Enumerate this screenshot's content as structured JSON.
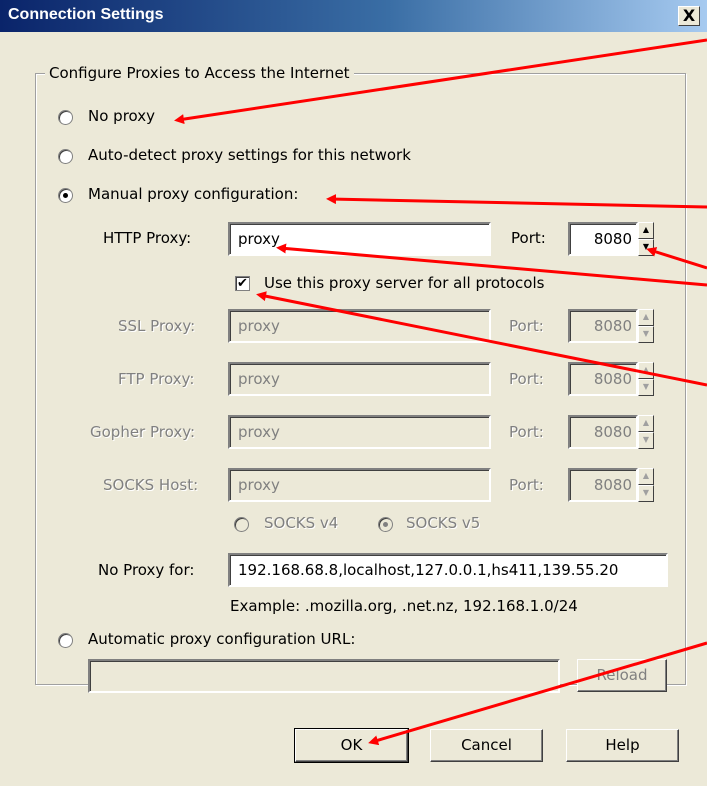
{
  "window": {
    "title": "Connection Settings",
    "close_label": "X"
  },
  "group": {
    "legend": "Configure Proxies to Access the Internet"
  },
  "options": {
    "no_proxy": "No proxy",
    "auto_detect": "Auto-detect proxy settings for this network",
    "manual": "Manual proxy configuration:",
    "auto_url": "Automatic proxy configuration URL:"
  },
  "manual": {
    "http": {
      "label": "HTTP Proxy:",
      "value": "proxy",
      "port_label": "Port:",
      "port": "8080"
    },
    "use_all_label": "Use this proxy server for all protocols",
    "use_all_checked": "✔",
    "ssl": {
      "label": "SSL Proxy:",
      "value": "proxy",
      "port_label": "Port:",
      "port": "8080"
    },
    "ftp": {
      "label": "FTP Proxy:",
      "value": "proxy",
      "port_label": "Port:",
      "port": "8080"
    },
    "gopher": {
      "label": "Gopher Proxy:",
      "value": "proxy",
      "port_label": "Port:",
      "port": "8080"
    },
    "socks": {
      "label": "SOCKS Host:",
      "value": "proxy",
      "port_label": "Port:",
      "port": "8080"
    },
    "socks_v4": "SOCKS v4",
    "socks_v5": "SOCKS v5",
    "no_proxy_label": "No Proxy for:",
    "no_proxy_value": "192.168.68.8,localhost,127.0.0.1,hs411,139.55.20",
    "example": "Example: .mozilla.org, .net.nz, 192.168.1.0/24"
  },
  "auto_url": {
    "value": "",
    "reload_label": "Reload"
  },
  "buttons": {
    "ok": "OK",
    "cancel": "Cancel",
    "help": "Help"
  },
  "colors": {
    "annotation_arrows": "#ff0000"
  }
}
